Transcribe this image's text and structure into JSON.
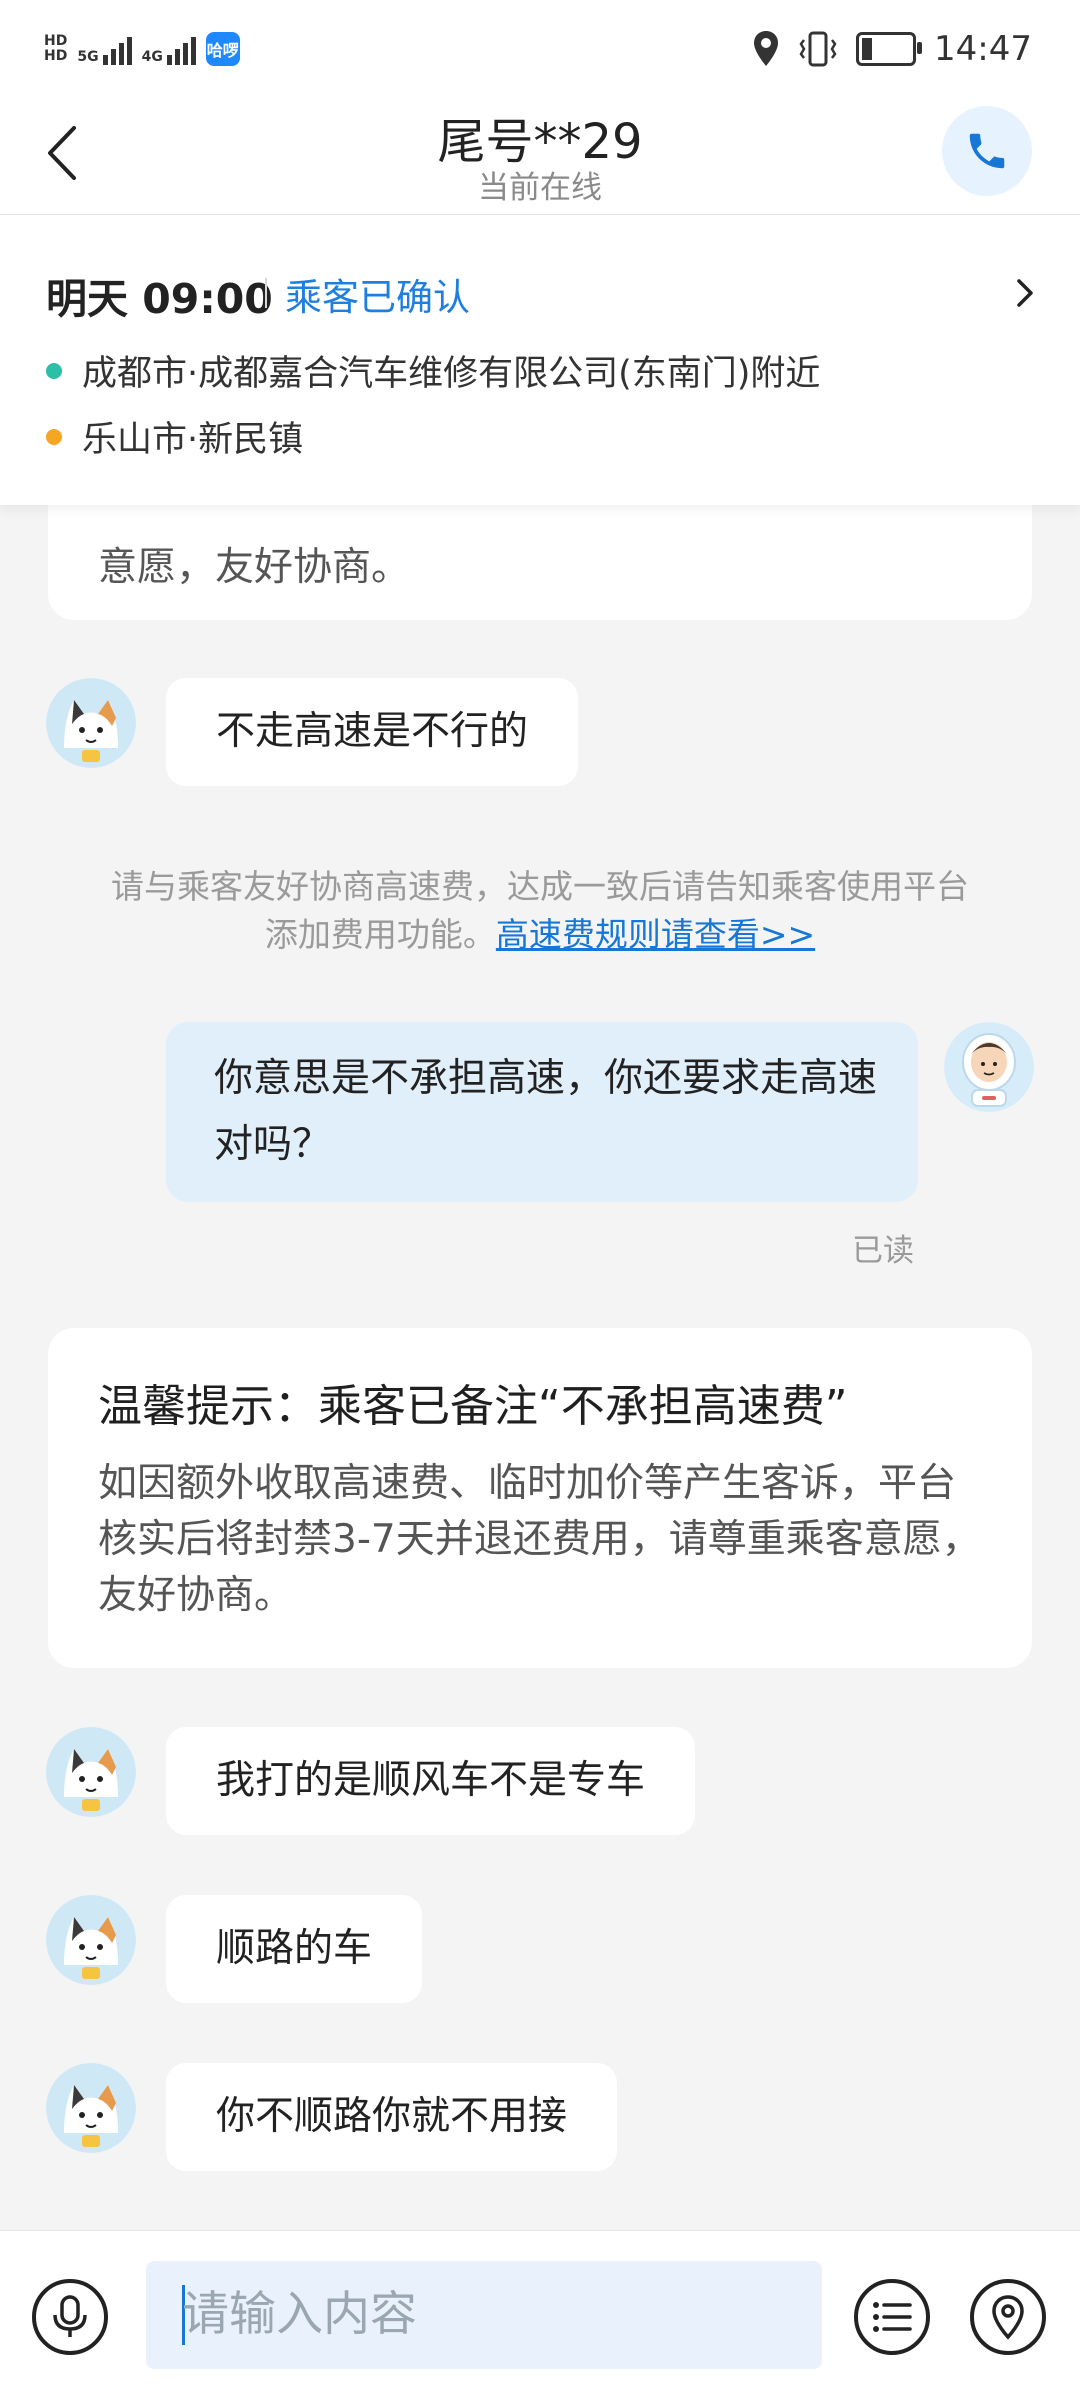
{
  "status_bar": {
    "hd1": "HD",
    "hd2": "HD",
    "net1": "5G",
    "net2": "4G",
    "app_badge": "哈啰",
    "time": "14:47",
    "battery_level": 0.2,
    "icons": [
      "location-icon",
      "vibrate-icon",
      "battery-icon"
    ]
  },
  "header": {
    "title": "尾号**29",
    "subtitle": "当前在线",
    "icons": {
      "back": "back-chevron-icon",
      "call": "phone-icon"
    },
    "accent": "#1677d6"
  },
  "trip": {
    "time": "明天 09:00",
    "status": "乘客已确认",
    "origin": "成都市·成都嘉合汽车维修有限公司(东南门)附近",
    "destination": "乐山市·新民镇",
    "origin_color": "#2bbfa6",
    "destination_color": "#f5a623"
  },
  "chat": {
    "top_card_tail": "意愿，友好协商。",
    "messages": [
      {
        "from": "passenger",
        "text": "不走高速是不行的"
      },
      {
        "from": "system",
        "text": "请与乘客友好协商高速费，达成一致后请告知乘客使用平台添加费用功能。",
        "link": "高速费规则请查看>>"
      },
      {
        "from": "driver",
        "text": "你意思是不承担高速，你还要求走高速对吗？",
        "status": "已读"
      },
      {
        "from": "notice",
        "title": "温馨提示：乘客已备注“不承担高速费”",
        "body": "如因额外收取高速费、临时加价等产生客诉，平台核实后将封禁3-7天并退还费用，请尊重乘客意愿，友好协商。"
      },
      {
        "from": "passenger",
        "text": "我打的是顺风车不是专车"
      },
      {
        "from": "passenger",
        "text": "顺路的车"
      },
      {
        "from": "passenger",
        "text": "你不顺路你就不用接"
      }
    ]
  },
  "input_bar": {
    "placeholder": "请输入内容",
    "icons": [
      "microphone-icon",
      "menu-list-icon",
      "location-pin-icon"
    ]
  }
}
